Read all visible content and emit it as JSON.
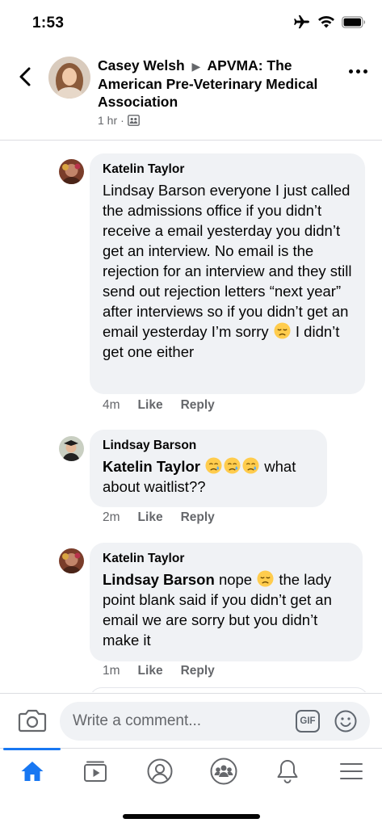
{
  "status_bar": {
    "time": "1:53"
  },
  "header": {
    "author": "Casey Welsh",
    "separator": "▶",
    "group": "APVMA: The American Pre-Veterinary Medical Association",
    "time": "1 hr",
    "dot": "·"
  },
  "comments": [
    {
      "name": "Katelin Taylor",
      "text_before": "Lindsay Barson everyone I just called the admissions office if you didn’t receive a email yesterday you didn’t get an interview. No email is the rejection for an interview and they still send out rejection letters “next year” after interviews so if you didn’t get an email yesterday I’m sorry",
      "emoji": "disappointed-face",
      "text_after": "I didn’t get one either",
      "time": "4m",
      "like": "Like",
      "reply": "Reply"
    },
    {
      "name": "Lindsay Barson",
      "mention": "Katelin Taylor",
      "emoji": "crying-face",
      "text": "what about waitlist??",
      "time": "2m",
      "like": "Like",
      "reply": "Reply"
    },
    {
      "name": "Katelin Taylor",
      "mention": "Lindsay Barson",
      "text_before": "nope",
      "emoji": "disappointed-face",
      "text_after": "the lady point blank said if you didn’t get an email we are sorry but you didn’t make it",
      "time": "1m",
      "like": "Like",
      "reply": "Reply"
    }
  ],
  "comment_bar": {
    "placeholder": "Write a comment...",
    "gif_label": "GIF"
  },
  "tabs": [
    {
      "icon": "home-icon",
      "active": true
    },
    {
      "icon": "watch-icon",
      "active": false
    },
    {
      "icon": "profile-icon",
      "active": false
    },
    {
      "icon": "groups-icon",
      "active": false
    },
    {
      "icon": "bell-icon",
      "active": false
    },
    {
      "icon": "menu-icon",
      "active": false
    }
  ],
  "colors": {
    "accent": "#1877f2",
    "bubble": "#f0f2f5",
    "secondary_text": "#65676b"
  }
}
